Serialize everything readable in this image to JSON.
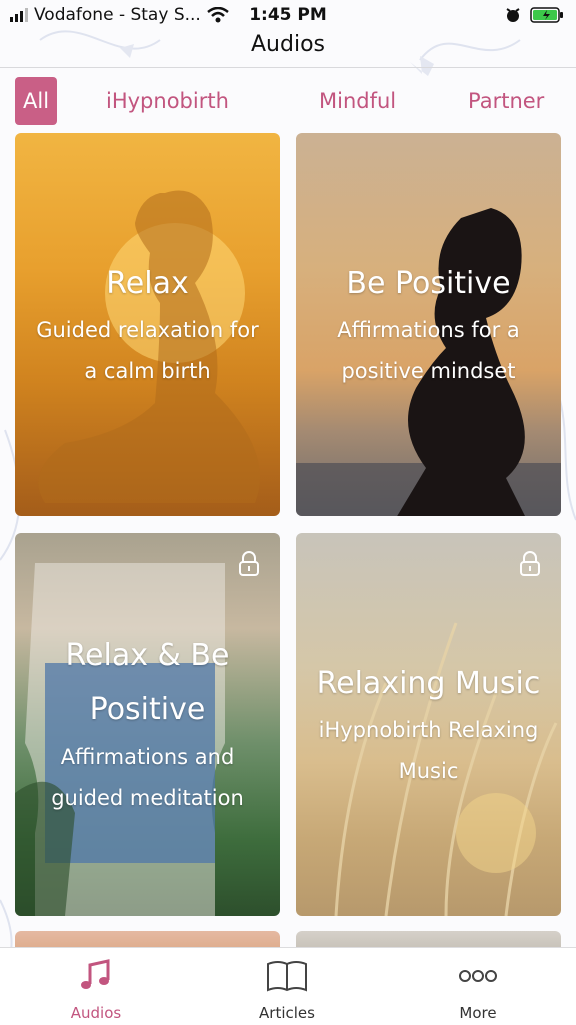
{
  "status_bar": {
    "carrier": "Vodafone - Stay S...",
    "time": "1:45 PM"
  },
  "header": {
    "title": "Audios"
  },
  "tabs": [
    {
      "label": "All",
      "active": true
    },
    {
      "label": "iHypnobirth"
    },
    {
      "label": "Mindful"
    },
    {
      "label": "Partner"
    }
  ],
  "cards": [
    {
      "title": "Relax",
      "subtitle_line1": "Guided relaxation for",
      "subtitle_line2": "a calm birth",
      "locked": false
    },
    {
      "title": "Be Positive",
      "subtitle_line1": "Affirmations for a",
      "subtitle_line2": "positive mindset",
      "locked": false
    },
    {
      "title_line1": "Relax & Be",
      "title_line2": "Positive",
      "subtitle_line1": "Affirmations and",
      "subtitle_line2": "guided meditation",
      "locked": true
    },
    {
      "title": "Relaxing Music",
      "subtitle_line1": "iHypnobirth Relaxing",
      "subtitle_line2": "Music",
      "locked": true
    }
  ],
  "tabbar": [
    {
      "label": "Audios",
      "icon": "music-note-icon",
      "active": true
    },
    {
      "label": "Articles",
      "icon": "book-icon"
    },
    {
      "label": "More",
      "icon": "more-dots-icon"
    }
  ],
  "colors": {
    "accent": "#c95f86",
    "accent_text": "#c2557f"
  }
}
